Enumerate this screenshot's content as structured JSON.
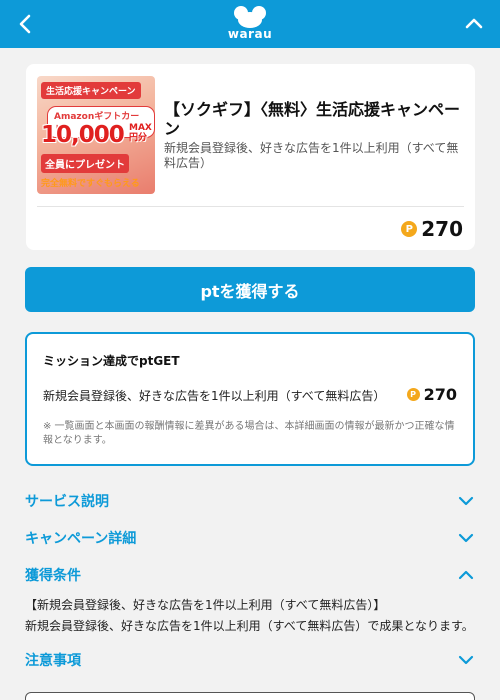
{
  "header": {
    "logo_text": "warau"
  },
  "offer": {
    "thumbnail": {
      "tag": "生活応援キャンペーン",
      "pill": "Amazonギフトカード",
      "amount": "10,000",
      "amount_suffix": "MAX 円分",
      "band": "全員にプレゼント",
      "footer": "完全無料ですぐもらえる"
    },
    "title": "【ソクギフ】〈無料〉生活応援キャンペーン",
    "description": "新規会員登録後、好きな広告を1件以上利用（すべて無料広告）",
    "points": "270",
    "coin_symbol": "P"
  },
  "get_button_label": "ptを獲得する",
  "mission": {
    "title": "ミッション達成でptGET",
    "condition": "新規会員登録後、好きな広告を1件以上利用（すべて無料広告）",
    "points": "270",
    "note": "※ 一覧画面と本画面の報酬情報に差異がある場合は、本詳細画面の情報が最新かつ正確な情報となります。"
  },
  "sections": {
    "service": "サービス説明",
    "campaign": "キャンペーン詳細",
    "conditions": "獲得条件",
    "caution": "注意事項"
  },
  "conditions_detail": {
    "line1": "【新規会員登録後、好きな広告を1件以上利用（すべて無料広告）】",
    "line2": "新規会員登録後、好きな広告を1件以上利用（すべて無料広告）で成果となります。"
  },
  "colors": {
    "brand_blue": "#0d9ad8",
    "coin_orange": "#f4a81c",
    "background": "#f2f2f2"
  }
}
